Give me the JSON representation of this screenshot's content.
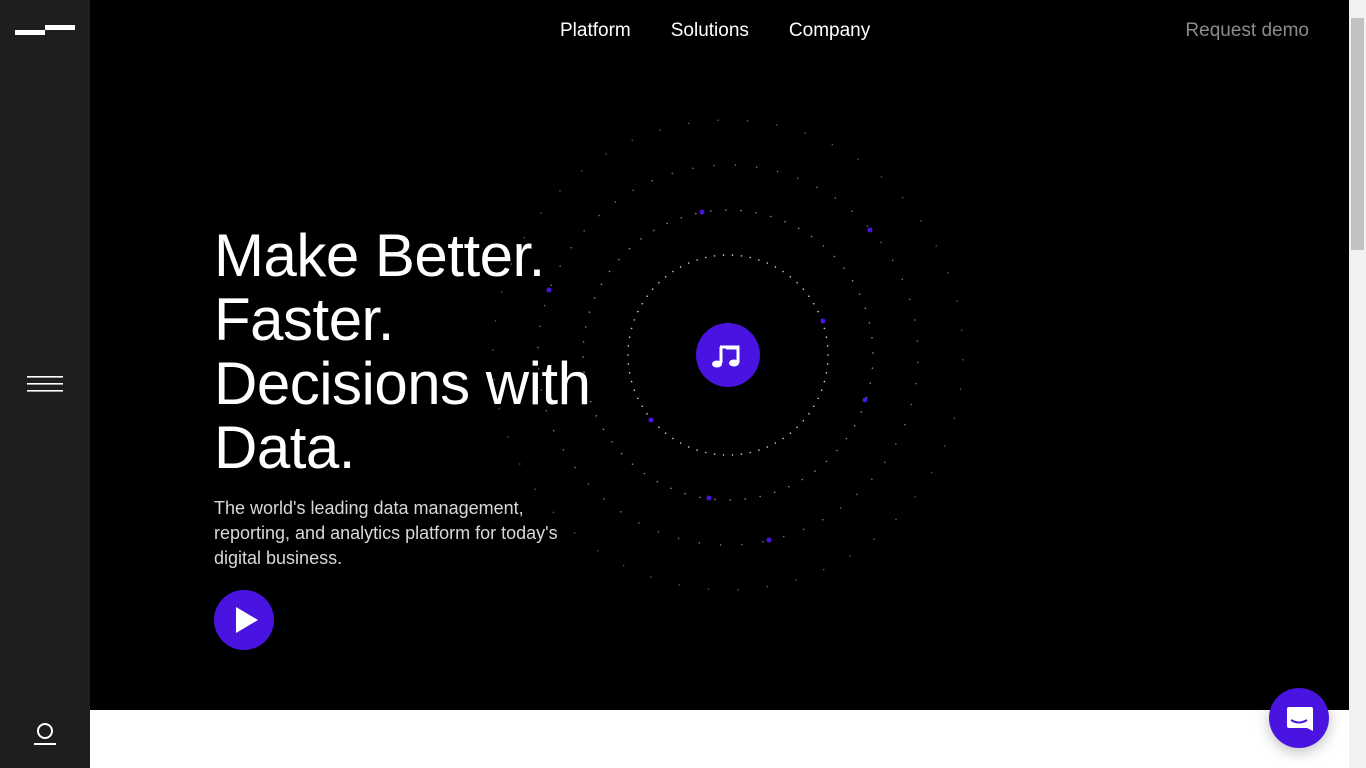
{
  "nav": {
    "items": [
      {
        "label": "Platform"
      },
      {
        "label": "Solutions"
      },
      {
        "label": "Company"
      }
    ],
    "request_demo": "Request demo"
  },
  "hero": {
    "headline_lines": [
      "Make Better.",
      "Faster.",
      "Decisions with",
      "Data."
    ],
    "description_lines": [
      "The world's leading data management,",
      "reporting, and analytics platform for today's",
      "digital business."
    ]
  },
  "icons": {
    "logo": "logo-bars",
    "menu": "hamburger-icon",
    "user": "user-icon",
    "play": "play-icon",
    "badge": "music-note-icon",
    "chat": "chat-icon"
  },
  "colors": {
    "accent": "#4a14e0",
    "sidebar": "#1e1e1e",
    "background": "#000000"
  }
}
